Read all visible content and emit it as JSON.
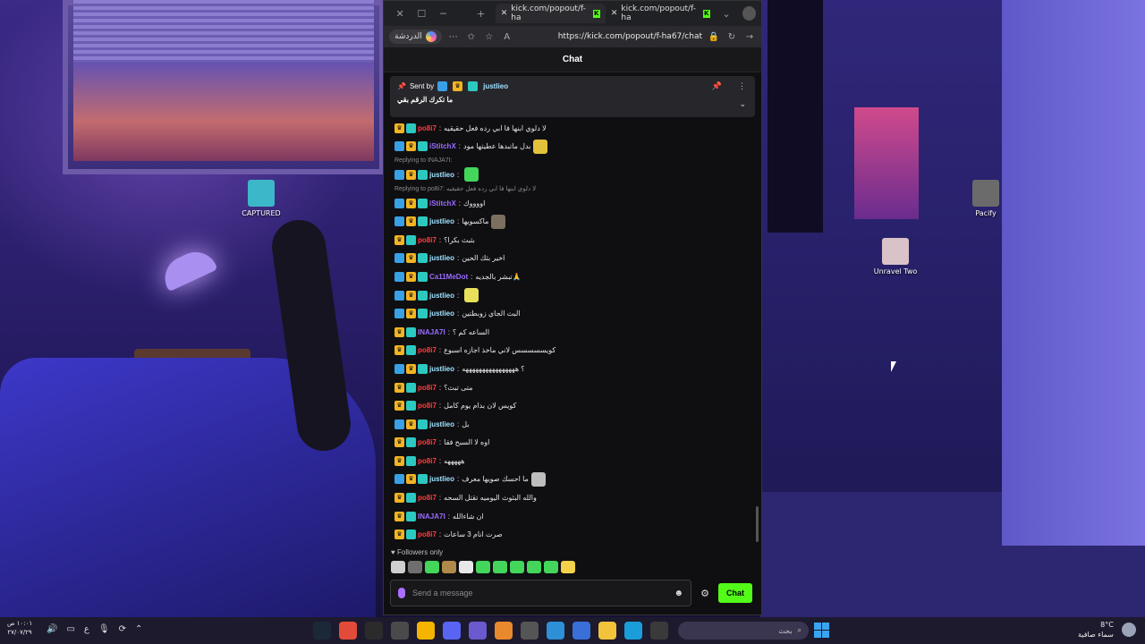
{
  "desktop": {
    "icons": [
      {
        "label": "CAPTURED",
        "color": "#3cb7c9"
      },
      {
        "label": "Pacify",
        "color": "#6b6b6b"
      },
      {
        "label": "Unravel Two",
        "color": "#d9c3c8"
      }
    ]
  },
  "browser": {
    "tabs": [
      {
        "label": "kick.com/popout/f-ha"
      },
      {
        "label": "kick.com/popout/f-ha"
      }
    ],
    "copilot_label": "الدردشة",
    "url": "https://kick.com/popout/f-ha67/chat"
  },
  "chat": {
    "header": "Chat",
    "pinned": {
      "sent_by_label": "Sent by",
      "user": "justlieo",
      "message": "ما تكرك الرقم بقي"
    },
    "messages": [
      {
        "type": "msg",
        "badges": [
          "gold",
          "teal"
        ],
        "user": "po8i7",
        "color": "#ff3d3d",
        "text": "لا دلوي ابنها فا ابي رده فعل حقيقيه"
      },
      {
        "type": "msg",
        "badges": [
          "blue",
          "gold",
          "teal"
        ],
        "user": "iStitchX",
        "color": "#9b6bff",
        "text": "بدل ماتبدها عطيتها مود",
        "emote": "#e2c23a"
      },
      {
        "type": "reply",
        "text": "Replying to INAJA7I:"
      },
      {
        "type": "msg",
        "badges": [
          "blue",
          "gold",
          "teal"
        ],
        "user": "justlieo",
        "color": "#9ee2ff",
        "text": "",
        "emote": "#43d65b"
      },
      {
        "type": "reply",
        "text": "Replying to po8i7: لا دلوي ابنها فا ابي رده فعل حقيقيه"
      },
      {
        "type": "msg",
        "badges": [
          "blue",
          "gold",
          "teal"
        ],
        "user": "iStitchX",
        "color": "#9b6bff",
        "text": "اووووك"
      },
      {
        "type": "msg",
        "badges": [
          "blue",
          "gold",
          "teal"
        ],
        "user": "justlieo",
        "color": "#9ee2ff",
        "text": "ماكسويها",
        "emote": "#7b6f5f"
      },
      {
        "type": "msg",
        "badges": [
          "gold",
          "teal"
        ],
        "user": "po8i7",
        "color": "#ff3d3d",
        "text": "بثبث بكرا؟"
      },
      {
        "type": "msg",
        "badges": [
          "blue",
          "gold",
          "teal"
        ],
        "user": "justlieo",
        "color": "#9ee2ff",
        "text": "اخير بثك الحين"
      },
      {
        "type": "msg",
        "badges": [
          "blue",
          "gold",
          "teal"
        ],
        "user": "Ca11MeDot",
        "color": "#9b6bff",
        "text": "تبشر بالجديه🙏"
      },
      {
        "type": "msg",
        "badges": [
          "blue",
          "gold",
          "teal"
        ],
        "user": "justlieo",
        "color": "#9ee2ff",
        "text": "",
        "emote": "#e8e05a"
      },
      {
        "type": "msg",
        "badges": [
          "blue",
          "gold",
          "teal"
        ],
        "user": "justlieo",
        "color": "#9ee2ff",
        "text": "البث الجاي زوبطتين"
      },
      {
        "type": "msg",
        "badges": [
          "gold",
          "teal"
        ],
        "user": "INAJA7I",
        "color": "#9b6bff",
        "text": "الساعه كم ؟"
      },
      {
        "type": "msg",
        "badges": [
          "gold",
          "teal"
        ],
        "user": "po8i7",
        "color": "#ff3d3d",
        "text": "كويسسسسس لاني ماخذ اجازه اسبوع"
      },
      {
        "type": "msg",
        "badges": [
          "blue",
          "gold",
          "teal"
        ],
        "user": "justlieo",
        "color": "#9ee2ff",
        "text": "؟ ههههههههههههههههه"
      },
      {
        "type": "msg",
        "badges": [
          "gold",
          "teal"
        ],
        "user": "po8i7",
        "color": "#ff3d3d",
        "text": "متى تبث؟"
      },
      {
        "type": "msg",
        "badges": [
          "gold",
          "teal"
        ],
        "user": "po8i7",
        "color": "#ff3d3d",
        "text": "كويس لان بدام يوم كامل"
      },
      {
        "type": "msg",
        "badges": [
          "blue",
          "gold",
          "teal"
        ],
        "user": "justlieo",
        "color": "#9ee2ff",
        "text": "بل"
      },
      {
        "type": "msg",
        "badges": [
          "gold",
          "teal"
        ],
        "user": "po8i7",
        "color": "#ff3d3d",
        "text": "اوه لا السبح فقا"
      },
      {
        "type": "msg",
        "badges": [
          "gold",
          "teal"
        ],
        "user": "po8i7",
        "color": "#ff3d3d",
        "text": "هههههه"
      },
      {
        "type": "msg",
        "badges": [
          "blue",
          "gold",
          "teal"
        ],
        "user": "justlieo",
        "color": "#9ee2ff",
        "text": "ما احسك صويها معرف",
        "emote": "#bdbdbd"
      },
      {
        "type": "msg",
        "badges": [
          "gold",
          "teal"
        ],
        "user": "po8i7",
        "color": "#ff3d3d",
        "text": "والله البثوث اليوميه تقتل السحه"
      },
      {
        "type": "msg",
        "badges": [
          "gold",
          "teal"
        ],
        "user": "INAJA7I",
        "color": "#9b6bff",
        "text": "ان شاءالله"
      },
      {
        "type": "msg",
        "badges": [
          "gold",
          "teal"
        ],
        "user": "po8i7",
        "color": "#ff3d3d",
        "text": "صرت انام 3 ساعات"
      }
    ],
    "followers_label": "Followers only",
    "emote_bar": [
      "#cfcfcf",
      "#6f6f6f",
      "#43d65b",
      "#b08a4a",
      "#e8e8e8",
      "#43d65b",
      "#43d65b",
      "#43d65b",
      "#43d65b",
      "#43d65b",
      "#f2d24a"
    ],
    "input_placeholder": "Send a message",
    "send_label": "Chat",
    "accent": "#53fc18"
  },
  "taskbar": {
    "time": "١٠:٠١ ص",
    "date": "٢٧/٠٧/٢٩",
    "search_placeholder": "بحث",
    "weather_temp": "8°C",
    "weather_desc": "سماء صافية",
    "lang": "ع",
    "apps": [
      {
        "name": "steam-icon",
        "color": "#1b2838"
      },
      {
        "name": "chrome-icon",
        "color": "#e24b3a"
      },
      {
        "name": "obs-icon",
        "color": "#2b2b2b"
      },
      {
        "name": "settings-icon",
        "color": "#4a4a4a"
      },
      {
        "name": "chrome-alt-icon",
        "color": "#f4b400"
      },
      {
        "name": "discord-icon",
        "color": "#5865f2"
      },
      {
        "name": "capcut-icon",
        "color": "#6a5acd"
      },
      {
        "name": "aimp-icon",
        "color": "#e8892e"
      },
      {
        "name": "app-icon",
        "color": "#555"
      },
      {
        "name": "edge-dev-icon",
        "color": "#2d8fd5"
      },
      {
        "name": "store-icon",
        "color": "#3a6fd8"
      },
      {
        "name": "folder-icon",
        "color": "#f3c33a"
      },
      {
        "name": "edge-icon",
        "color": "#1a9ed9"
      },
      {
        "name": "terminal-icon",
        "color": "#3a3a3a"
      }
    ]
  }
}
